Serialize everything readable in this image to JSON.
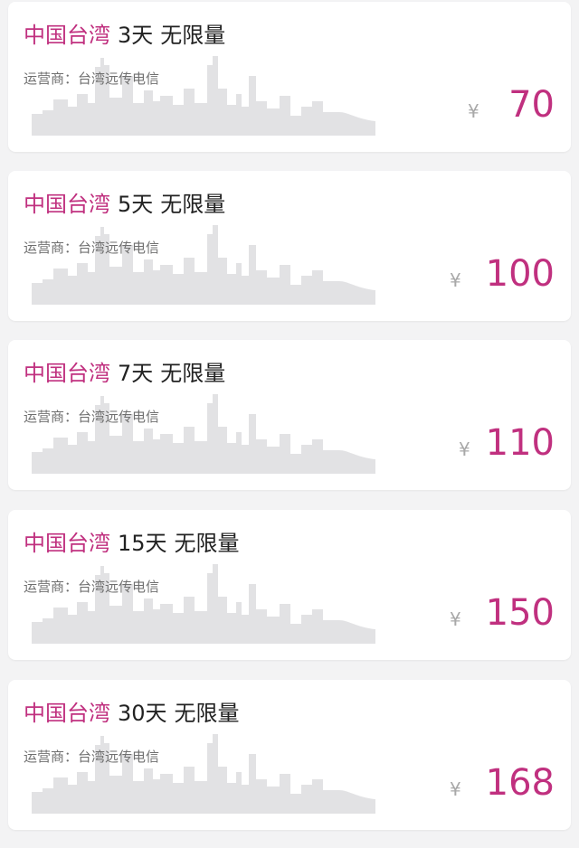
{
  "colors": {
    "accent": "#c0307f",
    "background": "#f3f3f4",
    "card": "#ffffff",
    "skyline": "#e2e2e4"
  },
  "icons": {
    "currency": "yen-sign",
    "card_background": "city-skyline"
  },
  "plans": [
    {
      "region": "中国台湾",
      "duration": "3天",
      "data_limit": "无限量",
      "operator_text": "运营商：台湾远传电信",
      "currency": "¥",
      "price": "70"
    },
    {
      "region": "中国台湾",
      "duration": "5天",
      "data_limit": "无限量",
      "operator_text": "运营商：台湾远传电信",
      "currency": "¥",
      "price": "100"
    },
    {
      "region": "中国台湾",
      "duration": "7天",
      "data_limit": "无限量",
      "operator_text": "运营商：台湾远传电信",
      "currency": "¥",
      "price": "110"
    },
    {
      "region": "中国台湾",
      "duration": "15天",
      "data_limit": "无限量",
      "operator_text": "运营商：台湾远传电信",
      "currency": "¥",
      "price": "150"
    },
    {
      "region": "中国台湾",
      "duration": "30天",
      "data_limit": "无限量",
      "operator_text": "运营商：台湾远传电信",
      "currency": "¥",
      "price": "168"
    }
  ]
}
